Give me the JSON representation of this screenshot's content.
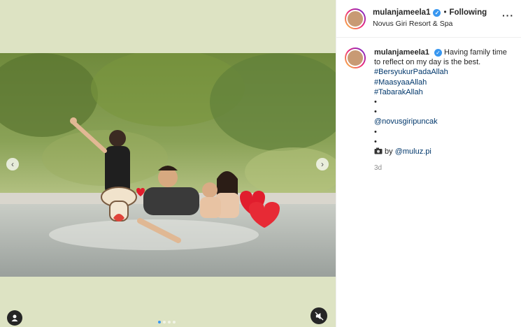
{
  "post": {
    "username": "mulanjameela1",
    "follow_status": "Following",
    "separator": "•",
    "location": "Novus Giri Resort & Spa",
    "more_icon": "more-horizontal-icon"
  },
  "caption": {
    "username": "mulanjameela1",
    "text": "Having family time to reflect on my day is the best.",
    "hashtags": [
      "#BersyukurPadaAllah",
      "#MaasyaaAllah",
      "#TabarakAllah"
    ],
    "bullets1": [
      "•",
      "•"
    ],
    "mention": "@novusgiripuncak",
    "bullets2": [
      "•",
      "•"
    ],
    "credit_prefix": "by",
    "credit_mention": "@muluz.pi",
    "timestamp": "3d"
  },
  "media": {
    "carousel_dots": 4,
    "active_dot": 0,
    "icons": [
      "chevron-left-icon",
      "chevron-right-icon",
      "user-tag-icon",
      "mute-icon",
      "camera-icon",
      "verified-badge-icon"
    ]
  },
  "colors": {
    "panel_bg": "#dde3c3",
    "link": "#00376b",
    "verified": "#3897f0"
  }
}
